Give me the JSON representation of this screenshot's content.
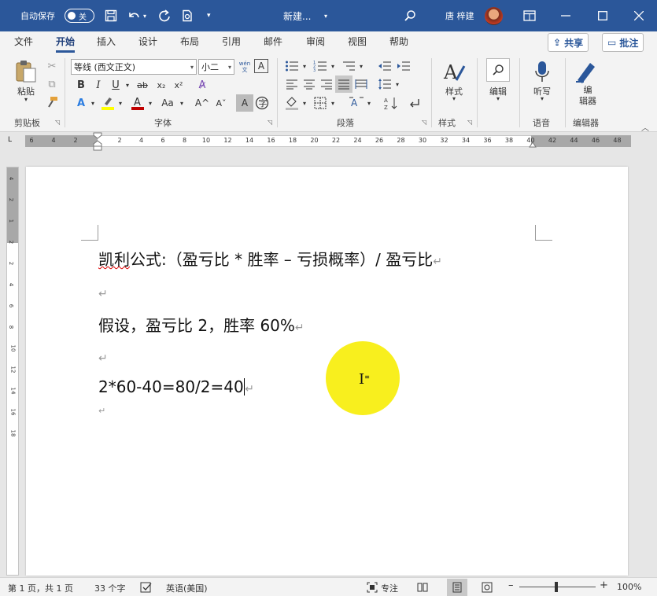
{
  "titlebar": {
    "autosave_label": "自动保存",
    "autosave_state": "关",
    "doc_title": "新建...",
    "user_name": "唐 梓建",
    "icons": [
      "save-icon",
      "undo-icon",
      "redo-icon",
      "print-icon",
      "customize-icon",
      "search-icon",
      "ribbon-display-icon",
      "minimize-icon",
      "maximize-icon",
      "close-icon"
    ]
  },
  "tabs": {
    "items": [
      "文件",
      "开始",
      "插入",
      "设计",
      "布局",
      "引用",
      "邮件",
      "审阅",
      "视图",
      "帮助"
    ],
    "active": "开始",
    "share_label": "共享",
    "comment_label": "批注"
  },
  "ribbon": {
    "clipboard": {
      "paste_label": "粘贴",
      "group_label": "剪贴板"
    },
    "font": {
      "font_name": "等线 (西文正文)",
      "font_size": "小二",
      "wen_label": "wén\n文",
      "group_label": "字体",
      "bold": "B",
      "italic": "I",
      "underline": "U",
      "strike": "ab",
      "sub": "x₂",
      "sup": "x²",
      "case_label": "Aa",
      "grow": "A^",
      "shrink": "Aˇ"
    },
    "paragraph": {
      "group_label": "段落"
    },
    "styles": {
      "label": "样式",
      "group_label": "样式"
    },
    "editing": {
      "label": "编辑"
    },
    "voice": {
      "label": "听写",
      "group_label": "语音"
    },
    "editor": {
      "label": "编\n辑器",
      "group_label": "编辑器"
    }
  },
  "ruler": {
    "left_ticks": [
      "6",
      "4",
      "2"
    ],
    "ticks": [
      "2",
      "4",
      "6",
      "8",
      "10",
      "12",
      "14",
      "16",
      "18",
      "20",
      "22",
      "24",
      "26",
      "28",
      "30",
      "32",
      "34",
      "36",
      "38",
      "40",
      "42",
      "44",
      "46",
      "48"
    ],
    "vticks": [
      "4",
      "2",
      "1",
      "2",
      "2",
      "4",
      "6",
      "8",
      "10",
      "12",
      "14",
      "16",
      "18"
    ]
  },
  "document": {
    "line1_prefix": "凯利",
    "line1_rest": "公式:（盈亏比 * 胜率 – 亏损概率）/ 盈亏比",
    "line3": "假设，盈亏比 2，胜率 60%",
    "line5": "2*60-40=80/2=40",
    "pilcrow": "↵"
  },
  "statusbar": {
    "page_info": "第 1 页，共 1 页",
    "word_count": "33 个字",
    "language": "英语(美国)",
    "focus_label": "专注",
    "zoom_minus": "–",
    "zoom_plus": "+",
    "zoom_level": "100%"
  },
  "colors": {
    "title_bar": "#2b579a",
    "highlight": "#f8ee12",
    "font_color_bar": "#c00000",
    "highlighter_bar": "#ffff00"
  }
}
